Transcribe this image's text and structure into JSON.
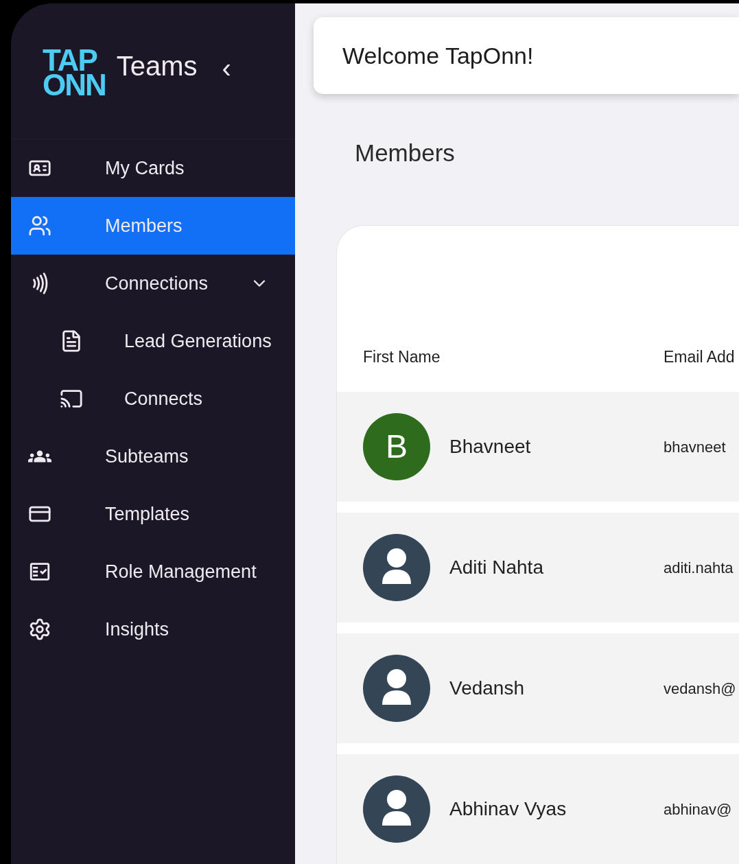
{
  "sidebar": {
    "logo_lines": [
      "TAP",
      "ONN"
    ],
    "title": "Teams",
    "collapse_icon": "‹",
    "items": [
      {
        "label": "My Cards",
        "selected": false
      },
      {
        "label": "Members",
        "selected": true
      },
      {
        "label": "Connections",
        "selected": false,
        "expanded": true,
        "children": [
          {
            "label": "Lead Generations",
            "selected": false
          },
          {
            "label": "Connects",
            "selected": false
          }
        ]
      },
      {
        "label": "Subteams",
        "selected": false
      },
      {
        "label": "Templates",
        "selected": false
      },
      {
        "label": "Role Management",
        "selected": false
      },
      {
        "label": "Insights",
        "selected": false
      }
    ]
  },
  "header": {
    "welcome": "Welcome TapOnn!"
  },
  "page_title": "Members",
  "table": {
    "columns": [
      "First Name",
      "Email Add"
    ],
    "rows": [
      {
        "avatar": {
          "kind": "initial",
          "letter": "B",
          "color": "#2e6b1c"
        },
        "first_name": "Bhavneet",
        "email": "bhavneet"
      },
      {
        "avatar": {
          "kind": "person"
        },
        "first_name": "Aditi Nahta",
        "email": "aditi.nahta"
      },
      {
        "avatar": {
          "kind": "person"
        },
        "first_name": "Vedansh",
        "email": "vedansh@"
      },
      {
        "avatar": {
          "kind": "person"
        },
        "first_name": "Abhinav Vyas",
        "email": "abhinav@"
      }
    ]
  }
}
